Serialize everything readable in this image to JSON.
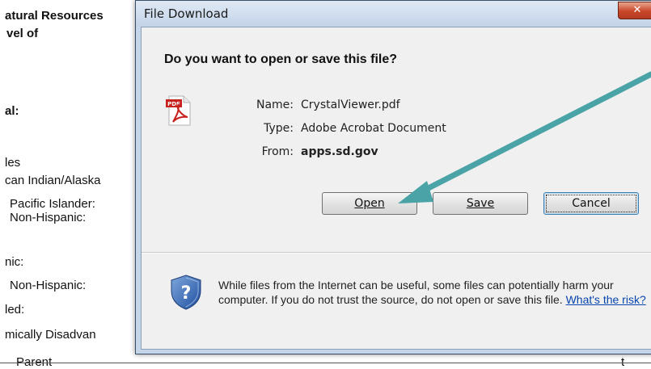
{
  "background_document": {
    "lines": [
      "atural Resources",
      "vel of",
      "al:",
      "les",
      "can Indian/Alaska",
      "Pacific Islander:",
      "Non-Hispanic:",
      "nic:",
      "Non-Hispanic:",
      "led:",
      "mically Disadvan"
    ],
    "bottom_cut": "Parent",
    "right_mark": "t"
  },
  "dialog": {
    "title": "File Download",
    "close_label": "✕",
    "question": "Do you want to open or save this file?",
    "file": {
      "name_label": "Name:",
      "name_value": "CrystalViewer.pdf",
      "type_label": "Type:",
      "type_value": "Adobe Acrobat Document",
      "from_label": "From:",
      "from_value": "apps.sd.gov"
    },
    "buttons": {
      "open": "Open",
      "save": "Save",
      "cancel": "Cancel"
    },
    "warning": {
      "text": "While files from the Internet can be useful, some files can potentially harm your computer. If you do not trust the source, do not open or save this file. ",
      "link": "What's the risk?"
    },
    "icons": {
      "file": "pdf-icon",
      "security": "shield-icon"
    }
  },
  "annotation": {
    "arrow_color": "#4aa3a6"
  }
}
